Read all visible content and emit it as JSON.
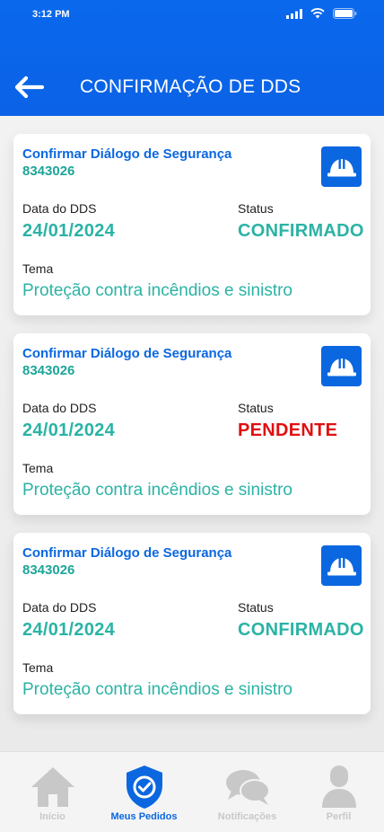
{
  "status_bar": {
    "time": "3:12 PM"
  },
  "header": {
    "title": "CONFIRMAÇÃO DE DDS"
  },
  "colors": {
    "primary": "#0b67e0",
    "teal": "#2bb3a5",
    "pending": "#e01010",
    "inactive": "#c8c8c8"
  },
  "cards": [
    {
      "title": "Confirmar Diálogo de Segurança",
      "id": "8343026",
      "date_label": "Data do DDS",
      "date": "24/01/2024",
      "status_label": "Status",
      "status": "CONFIRMADO",
      "tema_label": "Tema",
      "tema": "Proteção contra incêndios e sinistro",
      "icon": "helmet-icon"
    },
    {
      "title": "Confirmar Diálogo de Segurança",
      "id": "8343026",
      "date_label": "Data do DDS",
      "date": "24/01/2024",
      "status_label": "Status",
      "status": "PENDENTE",
      "tema_label": "Tema",
      "tema": "Proteção contra incêndios e sinistro",
      "icon": "helmet-icon"
    },
    {
      "title": "Confirmar Diálogo de Segurança",
      "id": "8343026",
      "date_label": "Data do DDS",
      "date": "24/01/2024",
      "status_label": "Status",
      "status": "CONFIRMADO",
      "tema_label": "Tema",
      "tema": "Proteção contra incêndios e sinistro",
      "icon": "helmet-icon"
    }
  ],
  "tabbar": {
    "items": [
      {
        "label": "Início",
        "icon": "home-icon",
        "active": false
      },
      {
        "label": "Meus Pedidos",
        "icon": "shield-check-icon",
        "active": true
      },
      {
        "label": "Notificações",
        "icon": "chat-bubbles-icon",
        "active": false
      },
      {
        "label": "Perfil",
        "icon": "user-icon",
        "active": false
      }
    ]
  }
}
